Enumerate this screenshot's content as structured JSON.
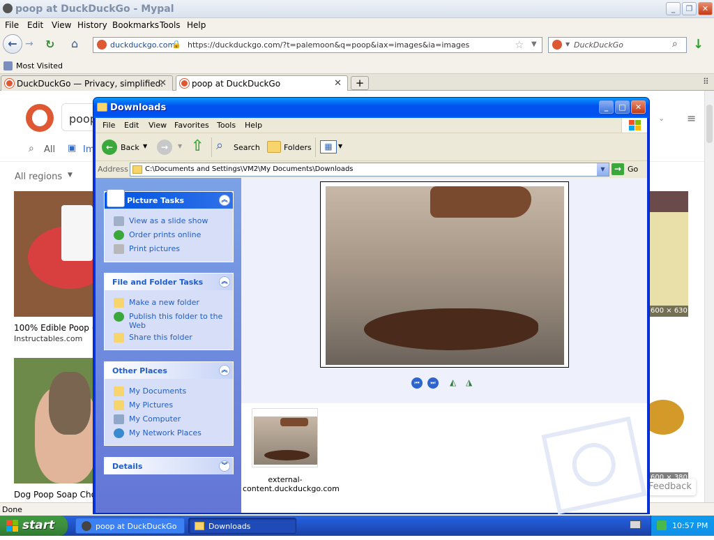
{
  "browser": {
    "title": "poop at DuckDuckGo - Mypal",
    "menu": [
      "File",
      "Edit",
      "View",
      "History",
      "Bookmarks",
      "Tools",
      "Help"
    ],
    "url_domain": "duckduckgo.com",
    "url": "https://duckduckgo.com/?t=palemoon&q=poop&iax=images&ia=images",
    "search_placeholder": "DuckDuckGo",
    "bookmark": "Most Visited",
    "tabs": [
      {
        "label": "DuckDuckGo — Privacy, simplified."
      },
      {
        "label": "poop at DuckDuckGo"
      }
    ],
    "status": "Done"
  },
  "page": {
    "search_text": "poop",
    "tab_all": "All",
    "tab_images": "Im",
    "filter_region": "All regions",
    "results": [
      {
        "title": "100% Edible Poop (",
        "source": "Instructables.com"
      },
      {
        "title": "Dog Poop Soap Cho",
        "source": ""
      }
    ],
    "right_size_1": "600 × 630",
    "right_size_2": "600 × 380",
    "feedback": "Feedback"
  },
  "explorer": {
    "title": "Downloads",
    "menu": [
      "File",
      "Edit",
      "View",
      "Favorites",
      "Tools",
      "Help"
    ],
    "toolbar": {
      "back": "Back",
      "search": "Search",
      "folders": "Folders"
    },
    "address_label": "Address",
    "address": "C:\\Documents and Settings\\VM2\\My Documents\\Downloads",
    "go": "Go",
    "picture_tasks": {
      "title": "Picture Tasks",
      "items": [
        "View as a slide show",
        "Order prints online",
        "Print pictures"
      ]
    },
    "file_tasks": {
      "title": "File and Folder Tasks",
      "items": [
        "Make a new folder",
        "Publish this folder to the Web",
        "Share this folder"
      ]
    },
    "other_places": {
      "title": "Other Places",
      "items": [
        "My Documents",
        "My Pictures",
        "My Computer",
        "My Network Places"
      ]
    },
    "details": {
      "title": "Details"
    },
    "file_name": "external-content.duckduckgo.com"
  },
  "taskbar": {
    "start": "start",
    "items": [
      "poop at DuckDuckGo ...",
      "Downloads"
    ],
    "clock": "10:57 PM"
  }
}
